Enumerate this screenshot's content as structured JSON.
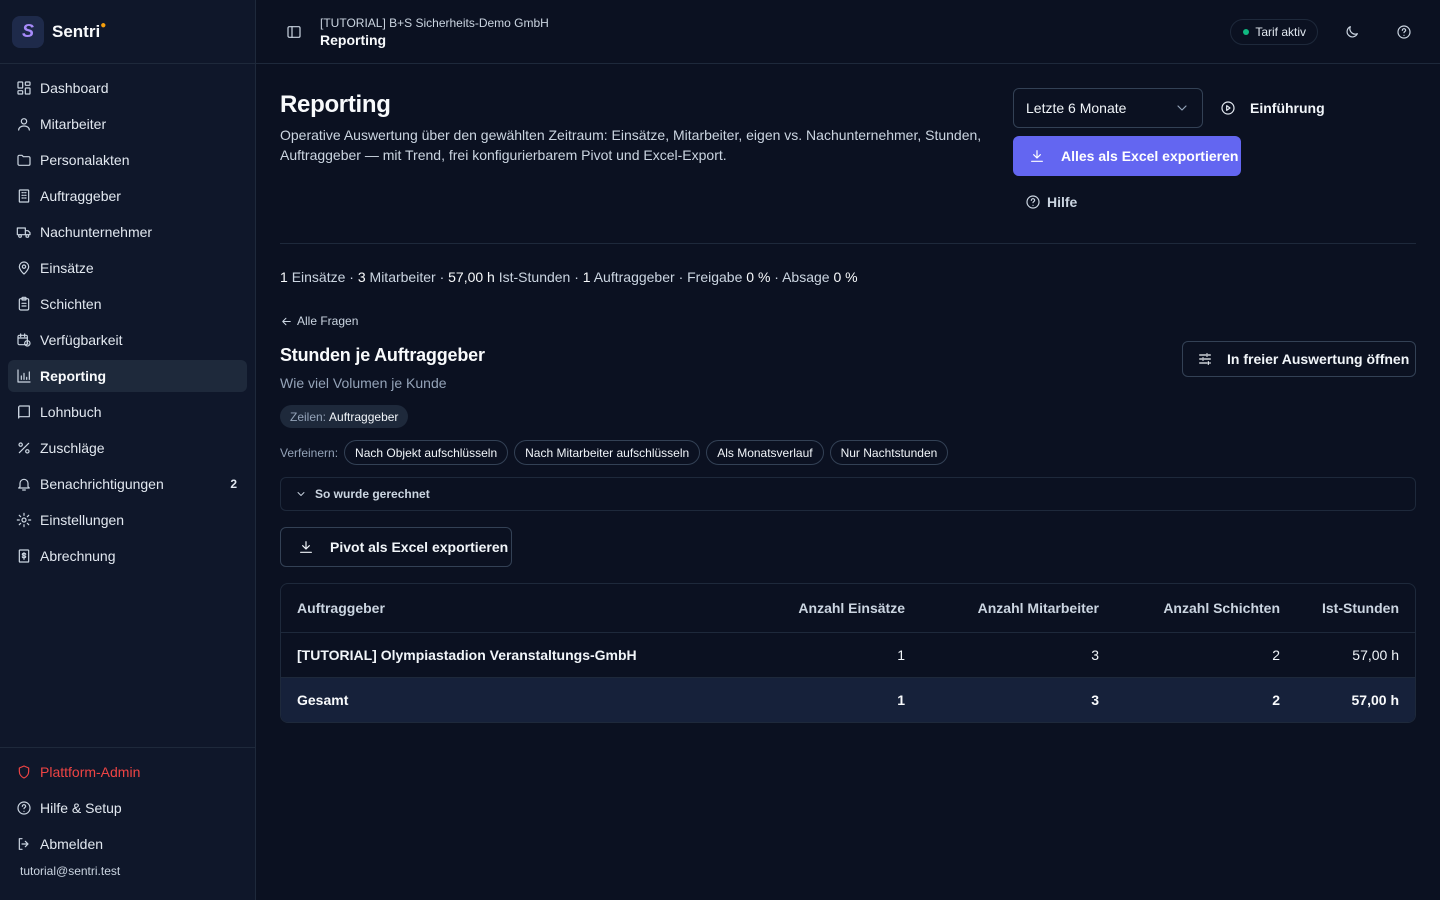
{
  "app": {
    "name": "Sentri",
    "logo_letter": "S"
  },
  "sidebar": {
    "items": [
      {
        "label": "Dashboard",
        "icon": "dashboard-icon"
      },
      {
        "label": "Mitarbeiter",
        "icon": "users-icon"
      },
      {
        "label": "Personalakten",
        "icon": "folder-icon"
      },
      {
        "label": "Auftraggeber",
        "icon": "building-icon"
      },
      {
        "label": "Nachunternehmer",
        "icon": "truck-icon"
      },
      {
        "label": "Einsätze",
        "icon": "map-pin-icon"
      },
      {
        "label": "Schichten",
        "icon": "clipboard-icon"
      },
      {
        "label": "Verfügbarkeit",
        "icon": "calendar-clock-icon"
      },
      {
        "label": "Reporting",
        "icon": "bar-chart-icon",
        "active": true
      },
      {
        "label": "Lohnbuch",
        "icon": "book-icon"
      },
      {
        "label": "Zuschläge",
        "icon": "percent-icon"
      },
      {
        "label": "Benachrichtigungen",
        "icon": "bell-icon",
        "badge": "2"
      },
      {
        "label": "Einstellungen",
        "icon": "gear-icon"
      },
      {
        "label": "Abrechnung",
        "icon": "receipt-icon"
      }
    ],
    "bottom": {
      "admin": "Plattform-Admin",
      "help": "Hilfe & Setup",
      "logout": "Abmelden",
      "email": "tutorial@sentri.test"
    }
  },
  "header": {
    "org": "[TUTORIAL] B+S Sicherheits-Demo GmbH",
    "page": "Reporting",
    "tarif": "Tarif aktiv"
  },
  "page": {
    "title": "Reporting",
    "description": "Operative Auswertung über den gewählten Zeitraum: Einsätze, Mitarbeiter, eigen vs. Nachunternehmer, Stunden, Auftraggeber — mit Trend, frei konfigurierbarem Pivot und Excel-Export.",
    "range_select": "Letzte 6 Monate",
    "intro_label": "Einführung",
    "export_all_label": "Alles als Excel exportieren",
    "help_label": "Hilfe"
  },
  "stats": {
    "einsaetze_value": "1",
    "einsaetze_label": "Einsätze",
    "mitarbeiter_value": "3",
    "mitarbeiter_label": "Mitarbeiter",
    "stunden_value": "57,00 h",
    "stunden_label": "Ist-Stunden",
    "auftraggeber_value": "1",
    "auftraggeber_label": "Auftraggeber",
    "freigabe_label": "Freigabe",
    "freigabe_value": "0 %",
    "absage_label": "Absage",
    "absage_value": "0 %",
    "sep": "·"
  },
  "question": {
    "back_label": "Alle Fragen",
    "title": "Stunden je Auftraggeber",
    "subtitle": "Wie viel Volumen je Kunde",
    "open_free_label": "In freier Auswertung öffnen",
    "rows_label": "Zeilen:",
    "rows_value": "Auftraggeber",
    "refine_label": "Verfeinern:",
    "refine_chips": [
      "Nach Objekt aufschlüsseln",
      "Nach Mitarbeiter aufschlüsseln",
      "Als Monatsverlauf",
      "Nur Nachtstunden"
    ],
    "calc_label": "So wurde gerechnet",
    "pivot_export_label": "Pivot als Excel exportieren"
  },
  "table": {
    "columns": [
      "Auftraggeber",
      "Anzahl Einsätze",
      "Anzahl Mitarbeiter",
      "Anzahl Schichten",
      "Ist-Stunden"
    ],
    "rows": [
      [
        "[TUTORIAL] Olympiastadion Veranstaltungs-GmbH",
        "1",
        "3",
        "2",
        "57,00 h"
      ]
    ],
    "total": [
      "Gesamt",
      "1",
      "3",
      "2",
      "57,00 h"
    ]
  },
  "colors": {
    "background": "#0b1121",
    "sidebar": "#0f172a",
    "accent": "#6366f1",
    "status_ok": "#10b981",
    "admin": "#ef4444"
  }
}
